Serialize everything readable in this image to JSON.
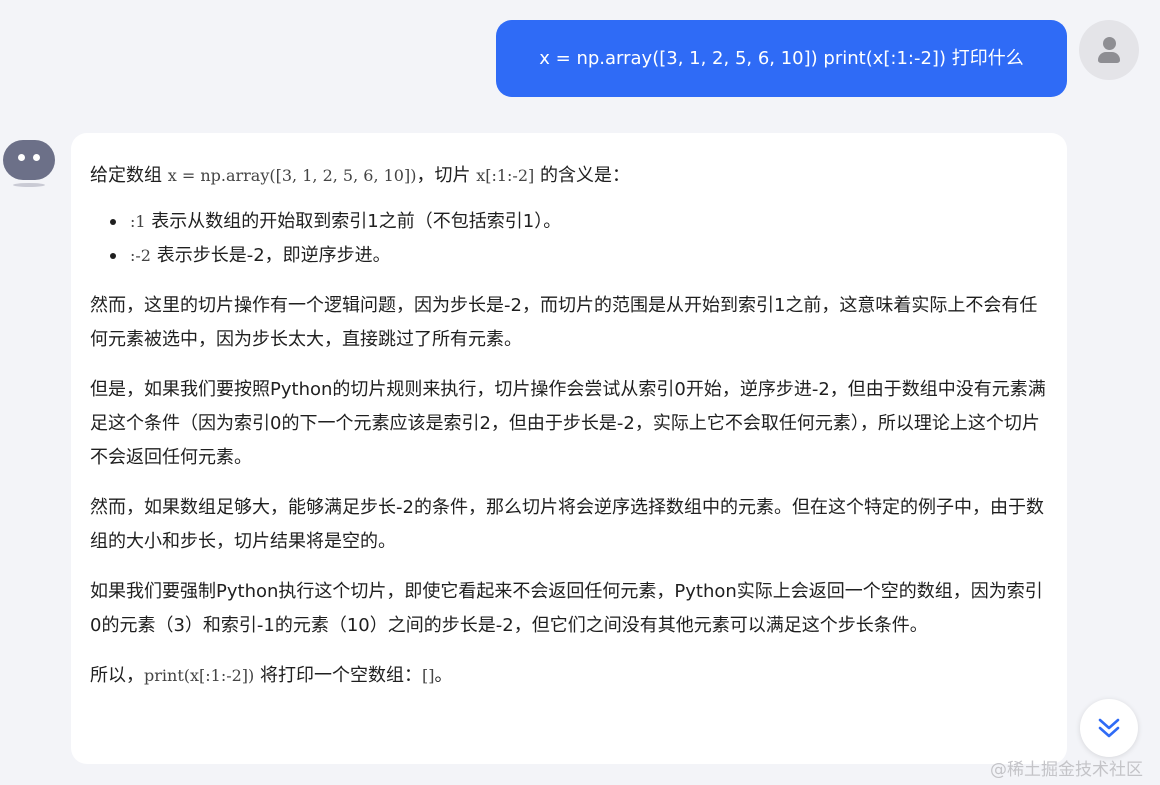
{
  "user_message": {
    "text": "x = np.array([3, 1, 2, 5, 6, 10]) print(x[:1:-2]) 打印什么"
  },
  "answer": {
    "intro": {
      "t1": "给定数组 ",
      "code1": "x = np.array([3, 1, 2, 5, 6, 10])",
      "t2": "，切片 ",
      "code2": "x[:1:-2]",
      "t3": " 的含义是："
    },
    "bullets": [
      {
        "code": ":1",
        "text": " 表示从数组的开始取到索引1之前（不包括索引1）。"
      },
      {
        "code": ":-2",
        "text": " 表示步长是-2，即逆序步进。"
      }
    ],
    "paragraphs": [
      "然而，这里的切片操作有一个逻辑问题，因为步长是-2，而切片的范围是从开始到索引1之前，这意味着实际上不会有任何元素被选中，因为步长太大，直接跳过了所有元素。",
      "但是，如果我们要按照Python的切片规则来执行，切片操作会尝试从索引0开始，逆序步进-2，但由于数组中没有元素满足这个条件（因为索引0的下一个元素应该是索引2，但由于步长是-2，实际上它不会取任何元素），所以理论上这个切片不会返回任何元素。",
      "然而，如果数组足够大，能够满足步长-2的条件，那么切片将会逆序选择数组中的元素。但在这个特定的例子中，由于数组的大小和步长，切片结果将是空的。",
      "如果我们要强制Python执行这个切片，即使它看起来不会返回任何元素，Python实际上会返回一个空的数组，因为索引0的元素（3）和索引-1的元素（10）之间的步长是-2，但它们之间没有其他元素可以满足这个步长条件。"
    ],
    "conclusion": {
      "t1": "所以，",
      "code": "print(x[:1:-2])",
      "t2": " 将打印一个空数组：",
      "code2": "[]",
      "t3": "。"
    }
  },
  "watermark": "@稀土掘金技术社区",
  "icons": {
    "user_avatar": "user-avatar-icon",
    "bot_avatar": "bot-avatar-icon",
    "scroll_down": "double-chevron-down-icon"
  },
  "colors": {
    "accent": "#2f6bf6",
    "background": "#f3f4f8",
    "card": "#ffffff"
  }
}
